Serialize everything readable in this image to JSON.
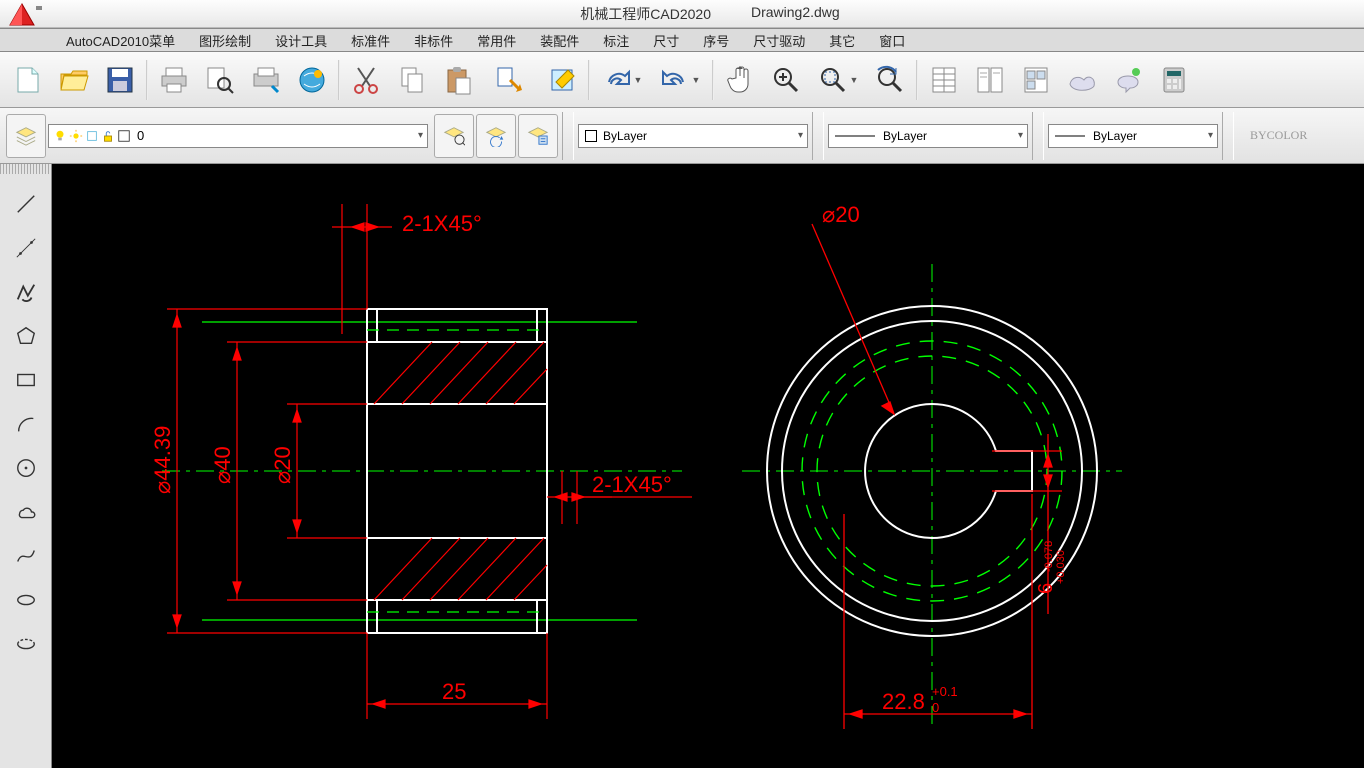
{
  "title": {
    "app": "机械工程师CAD2020",
    "file": "Drawing2.dwg"
  },
  "menu": [
    "AutoCAD2010菜单",
    "图形绘制",
    "设计工具",
    "标准件",
    "非标件",
    "常用件",
    "装配件",
    "标注",
    "尺寸",
    "序号",
    "尺寸驱动",
    "其它",
    "窗口"
  ],
  "layer": {
    "current": "0"
  },
  "props": {
    "color": "ByLayer",
    "linetype": "ByLayer",
    "lineweight": "ByLayer",
    "plotstyle": "BYCOLOR"
  },
  "dimensions": {
    "chamfer_top": "2-1X45°",
    "chamfer_bot": "2-1X45°",
    "dia_outer": "⌀44.39",
    "dia_mid": "⌀40",
    "dia_inner": "⌀20",
    "length": "25",
    "r_dia": "⌀20",
    "width_tol": "22.8",
    "width_tol_sup": "+0.1",
    "width_tol_sub": "0",
    "key_tol": "6",
    "key_tol_sup": "+0.030",
    "key_tol_sub": "-0.078"
  }
}
